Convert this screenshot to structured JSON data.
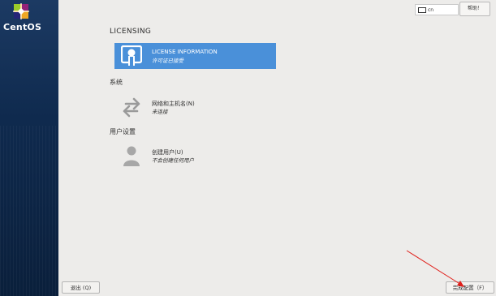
{
  "sidebar": {
    "brand": "CentOS"
  },
  "topbar": {
    "keyboard_layout": "cn",
    "help_label": "帮助！"
  },
  "sections": {
    "licensing": "LICENSING",
    "system": "系统",
    "user_settings": "用户设置"
  },
  "spokes": {
    "license": {
      "title": "LICENSE INFORMATION",
      "status": "许可证已接受",
      "icon": "license-icon"
    },
    "network": {
      "title": "网络和主机名(N)",
      "status": "未连接",
      "icon": "network-arrows-icon"
    },
    "user": {
      "title": "创建用户(U)",
      "status": "不会创建任何用户",
      "icon": "user-icon"
    }
  },
  "buttons": {
    "quit": "退出 (Q)",
    "finish": "完成配置（F）"
  },
  "colors": {
    "accent": "#4a90d9",
    "sidebar": "#0f2a4e",
    "annotation_arrow": "#e0201b"
  }
}
